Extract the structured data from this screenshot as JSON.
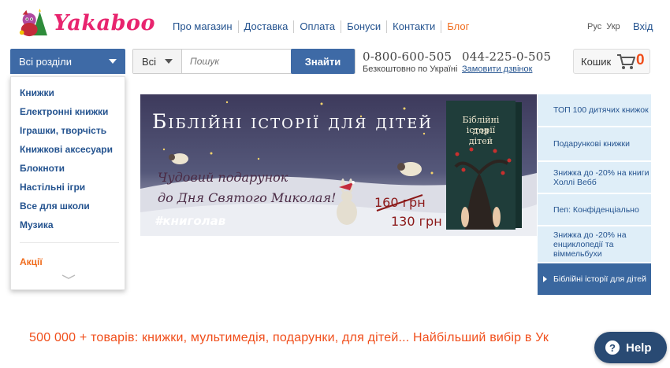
{
  "header": {
    "logo_text": "Yakaboo",
    "nav": [
      "Про магазин",
      "Доставка",
      "Оплата",
      "Бонуси",
      "Контакти",
      "Блог"
    ],
    "lang": [
      "Рус",
      "Укр"
    ],
    "login_label": "Вхід"
  },
  "search": {
    "category_button": "Всі розділи",
    "scope": "Всі",
    "placeholder": "Пошук",
    "submit_label": "Знайти"
  },
  "phones": [
    {
      "number": "0-800-600-505",
      "note": "Безкоштовно по Україні"
    },
    {
      "number": "044-225-0-505",
      "note": "Замовити дзвінок"
    }
  ],
  "cart": {
    "label": "Кошик",
    "count": "0"
  },
  "category_menu": {
    "items": [
      "Книжки",
      "Електронні книжки",
      "Іграшки, творчість",
      "Книжкові аксесуари",
      "Блокноти",
      "Настільні ігри",
      "Все для школи",
      "Музика"
    ],
    "promo": "Акції"
  },
  "banner": {
    "title": "Біблійні історії для дітей",
    "line1": "Чудовий подарунок",
    "line2": "до Дня Святого Миколая!",
    "old_price": "160 грн",
    "new_price": "130 грн",
    "hashtag": "#книголав",
    "book_title_1": "Біблійні історії",
    "book_title_2": "для",
    "book_title_3": "дітей"
  },
  "side_list": [
    "ТОП 100 дитячих книжок",
    "Подарункові книжки",
    "Знижка до -20% на книги Холлі Вебб",
    "Пеп: Конфіденціально",
    "Знижка до -20% на енциклопедії та віммельбухи",
    "Біблійні історії для дітей"
  ],
  "tagline": "500 000 + товарів: книжки, мультимедія, подарунки, для дітей... Найбільший вибір в Ук",
  "help_label": "Help",
  "colors": {
    "brand_blue": "#3e6aa6",
    "accent_orange": "#f06c1d",
    "logo_pink": "#e8246e"
  }
}
